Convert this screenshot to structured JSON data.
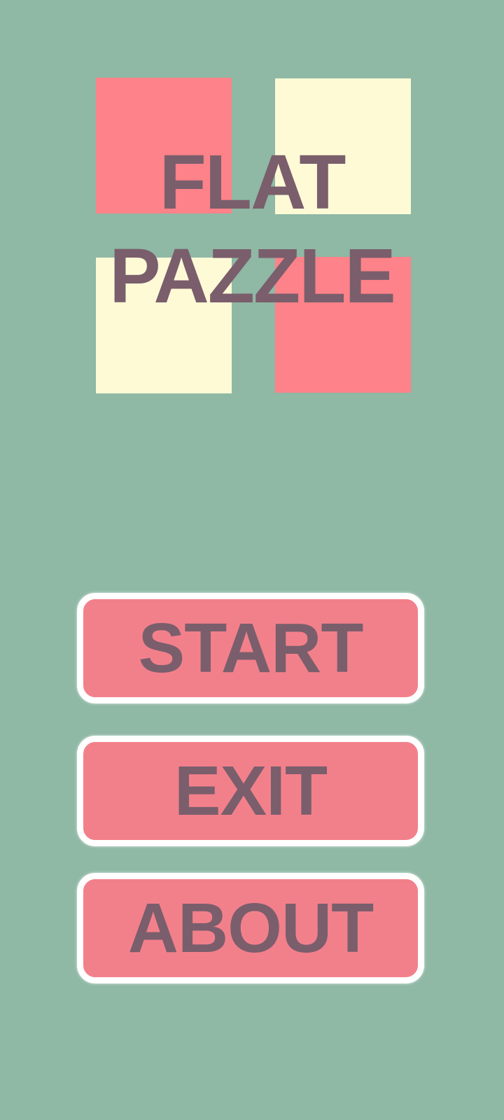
{
  "logo": {
    "title_line_1": "FLAT",
    "title_line_2": "PAZZLE",
    "tile_colors": {
      "pink": "#fe8289",
      "cream": "#fffad6"
    }
  },
  "menu": {
    "start_label": "START",
    "exit_label": "EXIT",
    "about_label": "ABOUT"
  },
  "colors": {
    "background": "#8fb8a5",
    "text": "#7a5e6c",
    "button_fill": "#f2808b",
    "button_border": "#ffffff"
  }
}
